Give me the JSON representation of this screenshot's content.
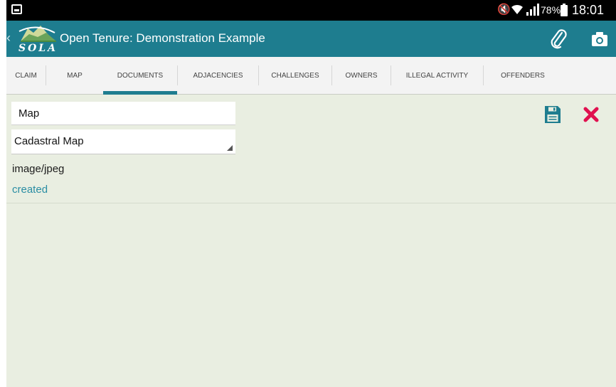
{
  "status_bar": {
    "battery": "78%",
    "time": "18:01",
    "icons": [
      "screenshot-icon",
      "mute-icon",
      "wifi-icon",
      "signal-icon",
      "battery-icon"
    ]
  },
  "action_bar": {
    "logo_text": "SOLA",
    "title": "Open Tenure: Demonstration Example",
    "actions": [
      "paperclip-icon",
      "camera-icon"
    ]
  },
  "tabs": [
    {
      "label": "CLAIM"
    },
    {
      "label": "MAP"
    },
    {
      "label": "DOCUMENTS",
      "selected": true
    },
    {
      "label": "ADJACENCIES"
    },
    {
      "label": "CHALLENGES"
    },
    {
      "label": "OWNERS"
    },
    {
      "label": "ILLEGAL ACTIVITY"
    },
    {
      "label": "OFFENDERS"
    }
  ],
  "document": {
    "name_value": "Map",
    "type_value": "Cadastral Map",
    "mime_type": "image/jpeg",
    "status": "created"
  },
  "colors": {
    "action_bar": "#1e7d8f",
    "background": "#e9eee1",
    "save_icon": "#1e7d8f",
    "delete_icon": "#e0114f",
    "status_link": "#2a8da3"
  }
}
